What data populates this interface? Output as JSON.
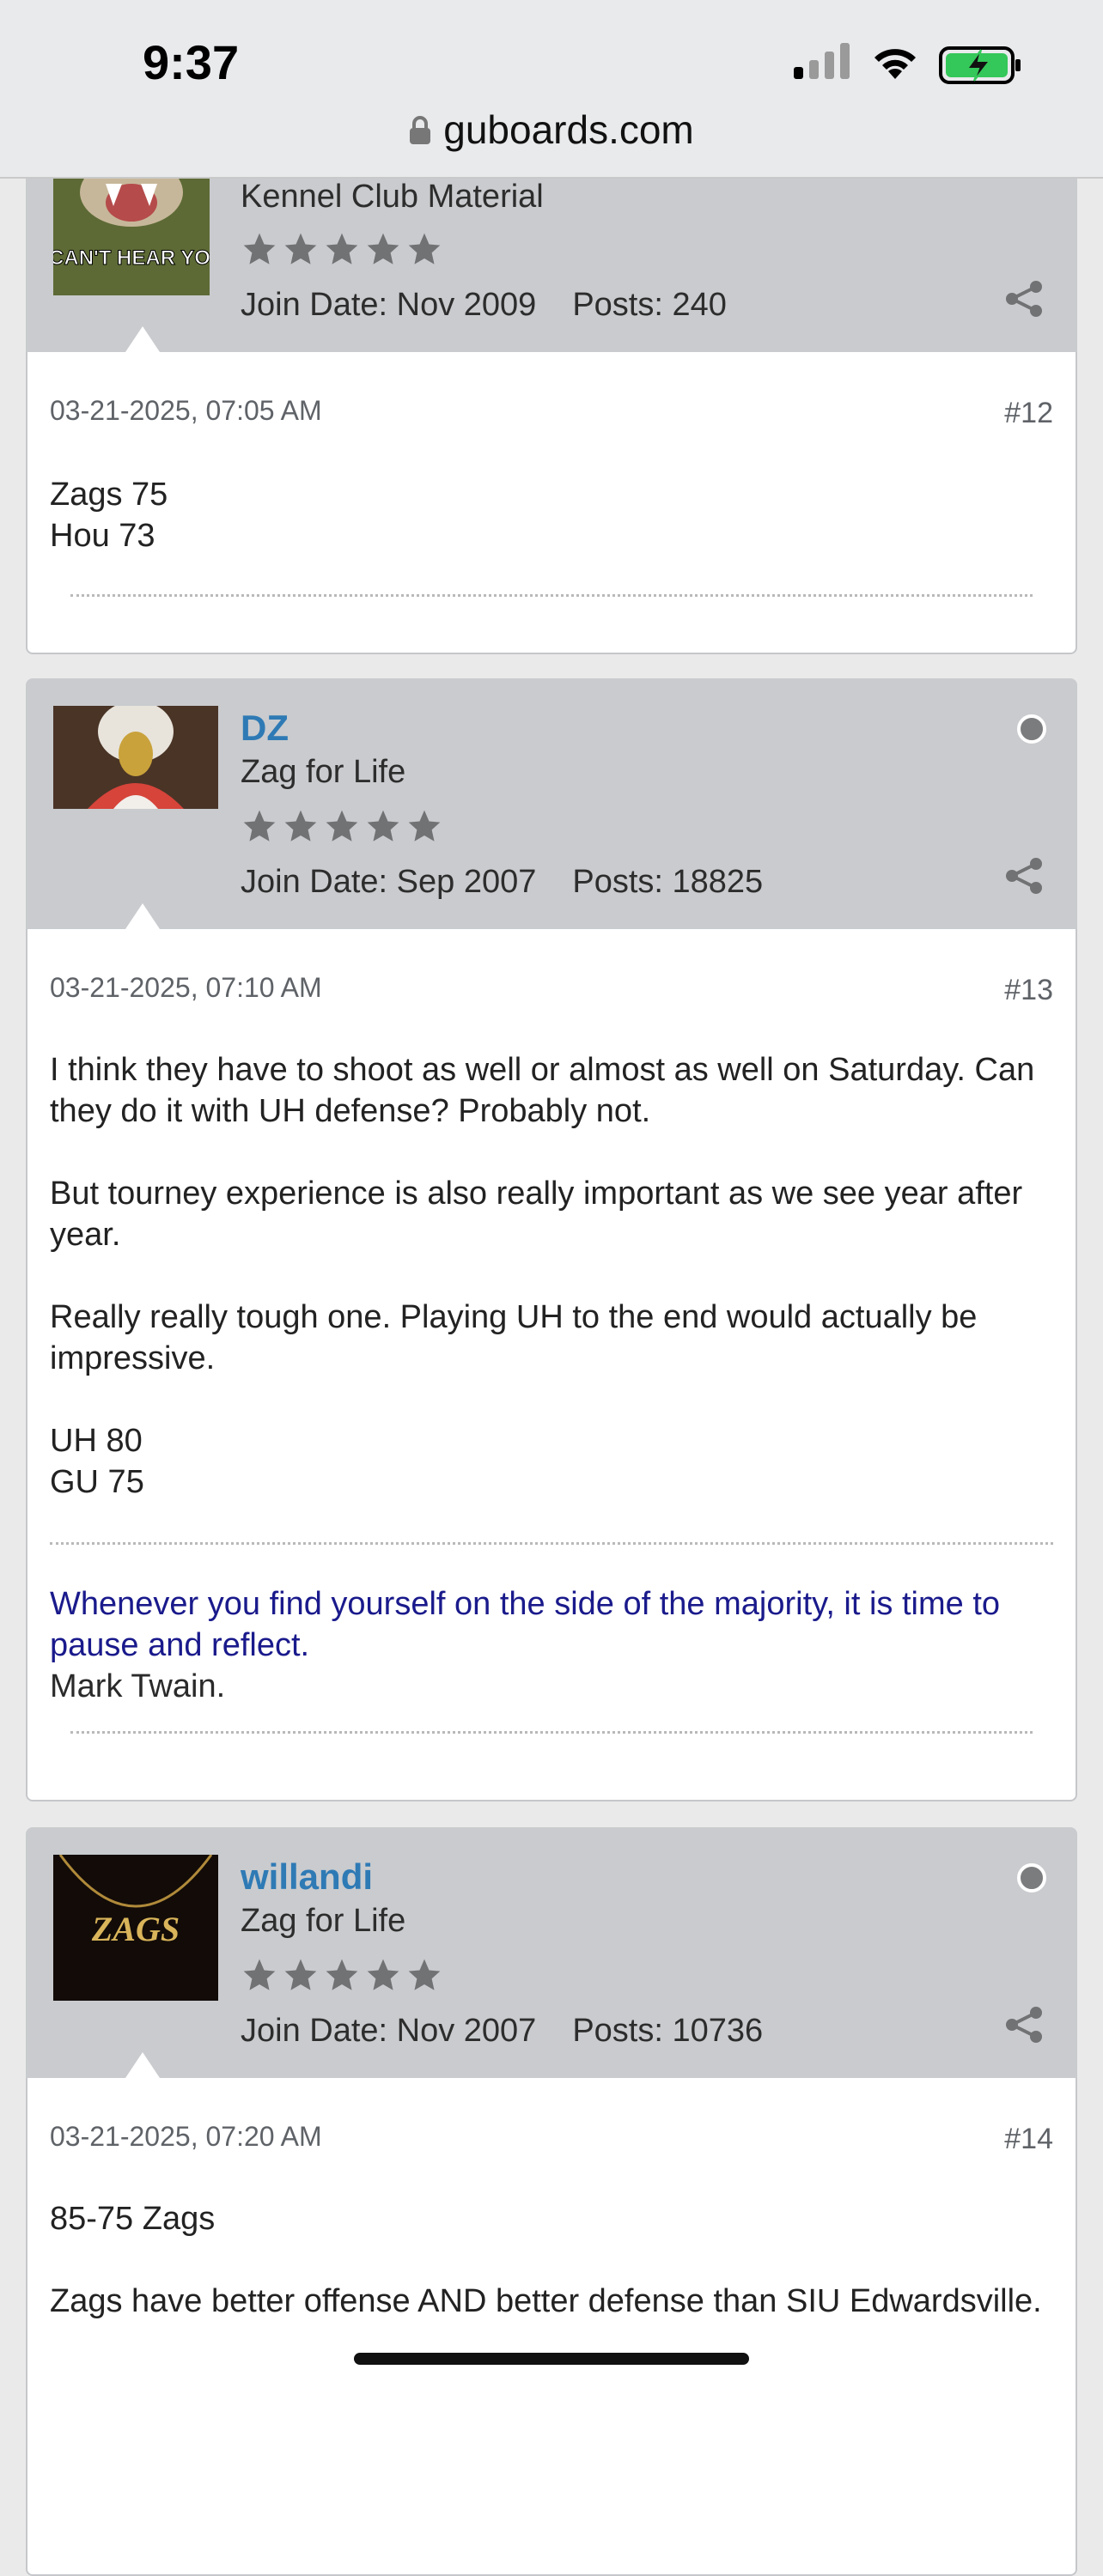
{
  "status_bar": {
    "time": "9:37",
    "url": "guboards.com"
  },
  "posts": [
    {
      "username": "",
      "title": "Kennel Club Material",
      "join_date": "Join Date: Nov 2009",
      "posts": "Posts: 240",
      "avatar_caption": "I CAN'T HEAR YOU",
      "date": "03-21-2025, 07:05 AM",
      "number": "#12",
      "paragraphs": [
        "Zags 75",
        "Hou 73"
      ]
    },
    {
      "username": "DZ",
      "title": "Zag for Life",
      "join_date": "Join Date: Sep 2007",
      "posts": "Posts: 18825",
      "date": "03-21-2025, 07:10 AM",
      "number": "#13",
      "paragraphs": [
        "I think they have to shoot as well or almost as well on Saturday. Can they do it with UH defense? Probably not.",
        "But tourney experience is also really important as we see year after year.",
        "Really really tough one. Playing UH to the end would actually be impressive.",
        "UH 80",
        "GU 75"
      ],
      "signature_quote": "Whenever you find yourself on the side of the majority, it is time to pause and reflect.",
      "signature_author": "Mark Twain."
    },
    {
      "username": "willandi",
      "title": "Zag for Life",
      "join_date": "Join Date: Nov 2007",
      "posts": "Posts: 10736",
      "avatar_caption": "ZAGS",
      "date": "03-21-2025, 07:20 AM",
      "number": "#14",
      "paragraphs": [
        "85-75 Zags",
        "Zags have better offense AND better defense than SIU Edwardsville."
      ]
    }
  ],
  "icons": {
    "status": [
      "signal-icon",
      "wifi-icon",
      "battery-charging-icon",
      "lock-icon"
    ],
    "post": [
      "star-icon",
      "online-status-icon",
      "share-icon"
    ]
  },
  "colors": {
    "username": "#2e7ab5",
    "signature_quote": "#1a1a8c",
    "header_bg": "#c9cbce",
    "battery": "#34c759"
  }
}
